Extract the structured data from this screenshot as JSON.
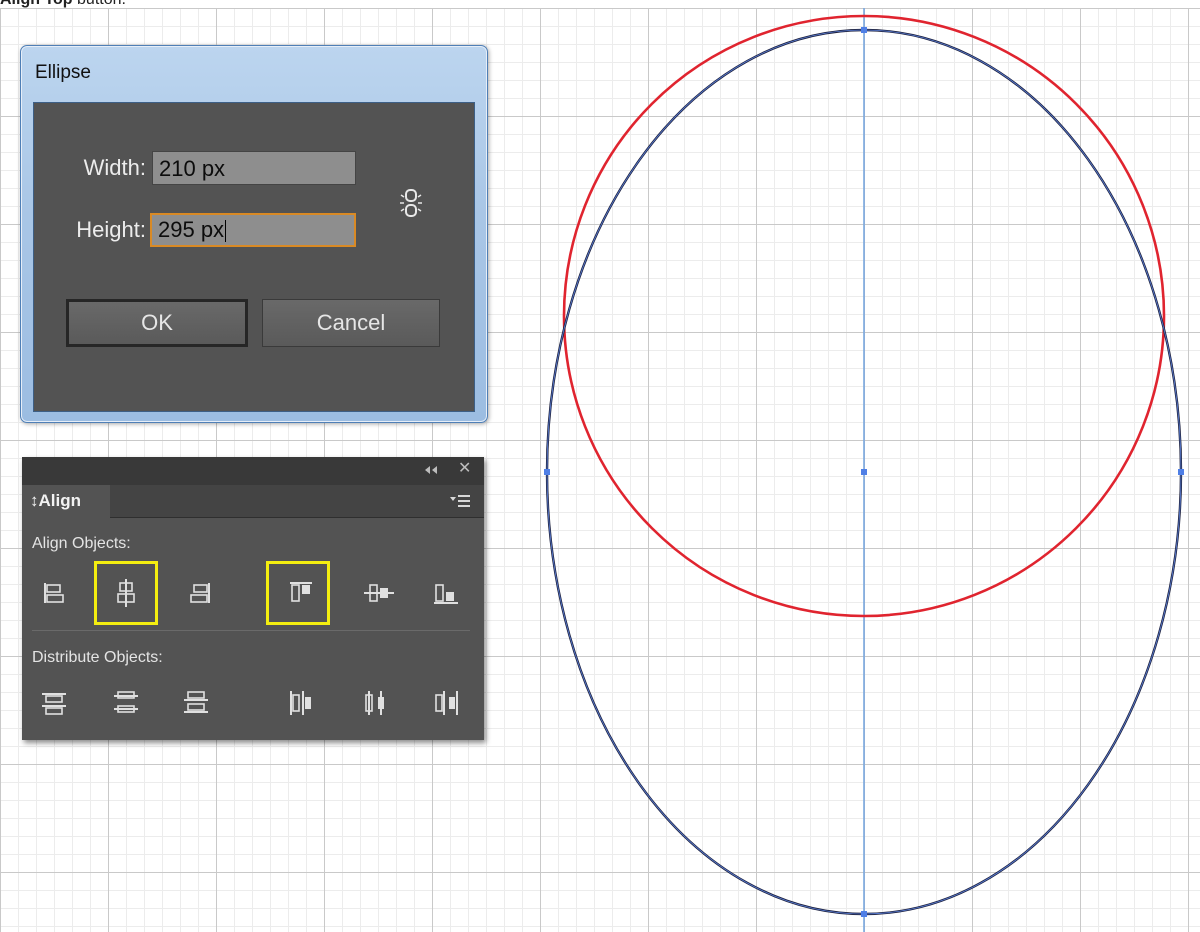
{
  "caption": {
    "bold": "Align Top",
    "rest": " button."
  },
  "ellipse_dialog": {
    "title": "Ellipse",
    "width_label": "Width:",
    "width_value": "210 px",
    "height_label": "Height:",
    "height_value": "295 px",
    "ok_label": "OK",
    "cancel_label": "Cancel"
  },
  "align_panel": {
    "tab_label": "Align",
    "tab_prefix": "↕",
    "align_objects_label": "Align Objects:",
    "distribute_objects_label": "Distribute Objects:"
  },
  "colors": {
    "circle": "#e0242f",
    "ellipse": "#1f2340",
    "guide": "#7aa8e0",
    "anchor": "#4f7fe6",
    "highlight": "#f4ee10"
  }
}
